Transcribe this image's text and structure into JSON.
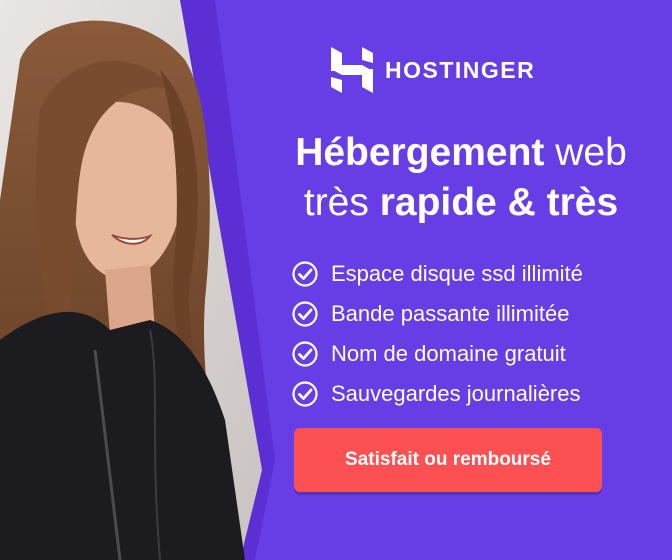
{
  "brand": {
    "name": "HOSTINGER",
    "logo_icon": "hostinger-h-icon"
  },
  "headline": {
    "line1_bold": "Hébergement",
    "line1_light": "web",
    "line2_light": "très",
    "line2_bold": "rapide & très"
  },
  "features": [
    {
      "icon": "check-circle-icon",
      "label": "Espace disque ssd illimité"
    },
    {
      "icon": "check-circle-icon",
      "label": "Bande passante illimitée"
    },
    {
      "icon": "check-circle-icon",
      "label": "Nom de domaine gratuit"
    },
    {
      "icon": "check-circle-icon",
      "label": "Sauvegardes journalières"
    }
  ],
  "cta": {
    "label": "Satisfait ou remboursé"
  },
  "colors": {
    "background": "#673de6",
    "accent_purple": "#5b2fd3",
    "cta": "#fc5052",
    "text": "#ffffff"
  }
}
